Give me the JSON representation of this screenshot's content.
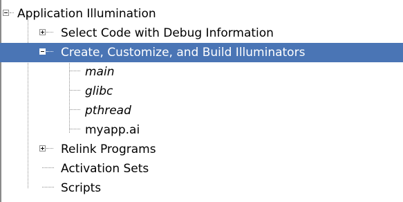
{
  "tree": {
    "root": {
      "label": "Application Illumination",
      "expander": "minus-expander-icon"
    },
    "items": [
      {
        "label": "Select Code with Debug Information",
        "expander": "plus-expander-icon",
        "selected": false
      },
      {
        "label": "Create, Customize, and Build Illuminators",
        "expander": "minus-expander-icon",
        "selected": true,
        "children": [
          {
            "label": "main",
            "italic": true
          },
          {
            "label": "glibc",
            "italic": true
          },
          {
            "label": "pthread",
            "italic": true
          },
          {
            "label": "myapp.ai",
            "italic": false
          }
        ]
      },
      {
        "label": "Relink Programs",
        "expander": "plus-expander-icon",
        "selected": false
      },
      {
        "label": "Activation Sets",
        "selected": false
      },
      {
        "label": "Scripts",
        "selected": false
      }
    ]
  },
  "colors": {
    "selection": "#4a75b5",
    "selection_text": "#ffffff",
    "tree_lines": "#8c8c8c"
  }
}
